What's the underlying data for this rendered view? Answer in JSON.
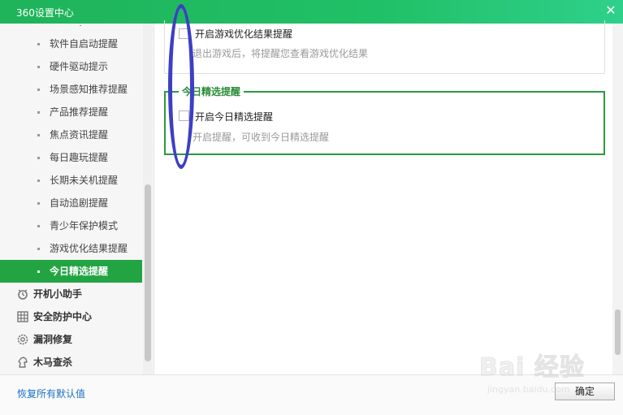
{
  "window": {
    "title": "360设置中心",
    "close_glyph": "✕"
  },
  "sidebar": {
    "subitems": [
      {
        "label": "软件自启动提醒"
      },
      {
        "label": "硬件驱动提示"
      },
      {
        "label": "场景感知推荐提醒"
      },
      {
        "label": "产品推荐提醒"
      },
      {
        "label": "焦点资讯提醒"
      },
      {
        "label": "每日趣玩提醒"
      },
      {
        "label": "长期未关机提醒"
      },
      {
        "label": "自动追剧提醒"
      },
      {
        "label": "青少年保护模式"
      },
      {
        "label": "游戏优化结果提醒"
      },
      {
        "label": "今日精选提醒",
        "active": true
      }
    ],
    "categories": [
      {
        "label": "开机小助手",
        "icon": "clock-icon"
      },
      {
        "label": "安全防护中心",
        "icon": "shield-grid-icon"
      },
      {
        "label": "漏洞修复",
        "icon": "gear-icon"
      },
      {
        "label": "木马查杀",
        "icon": "horse-icon"
      }
    ]
  },
  "content": {
    "prev_option": {
      "label": "开启游戏优化结果提醒",
      "desc": "退出游戏后，将提醒您查看游戏优化结果",
      "checked": false
    },
    "group": {
      "title": "今日精选提醒",
      "option": {
        "label": "开启今日精选提醒",
        "desc": "开启提醒，可收到今日精选提醒",
        "checked": false
      }
    }
  },
  "footer": {
    "restore_label": "恢复所有默认值",
    "ok_label": "确定"
  },
  "watermark": {
    "brand": "Bai 经验",
    "url": "jingyan.baidu.com"
  },
  "colors": {
    "titlebar": "#20c067",
    "active_item": "#22a443",
    "group_border": "#2a9a3e",
    "annotation": "#3d3fc4",
    "link": "#1a6fc4"
  }
}
